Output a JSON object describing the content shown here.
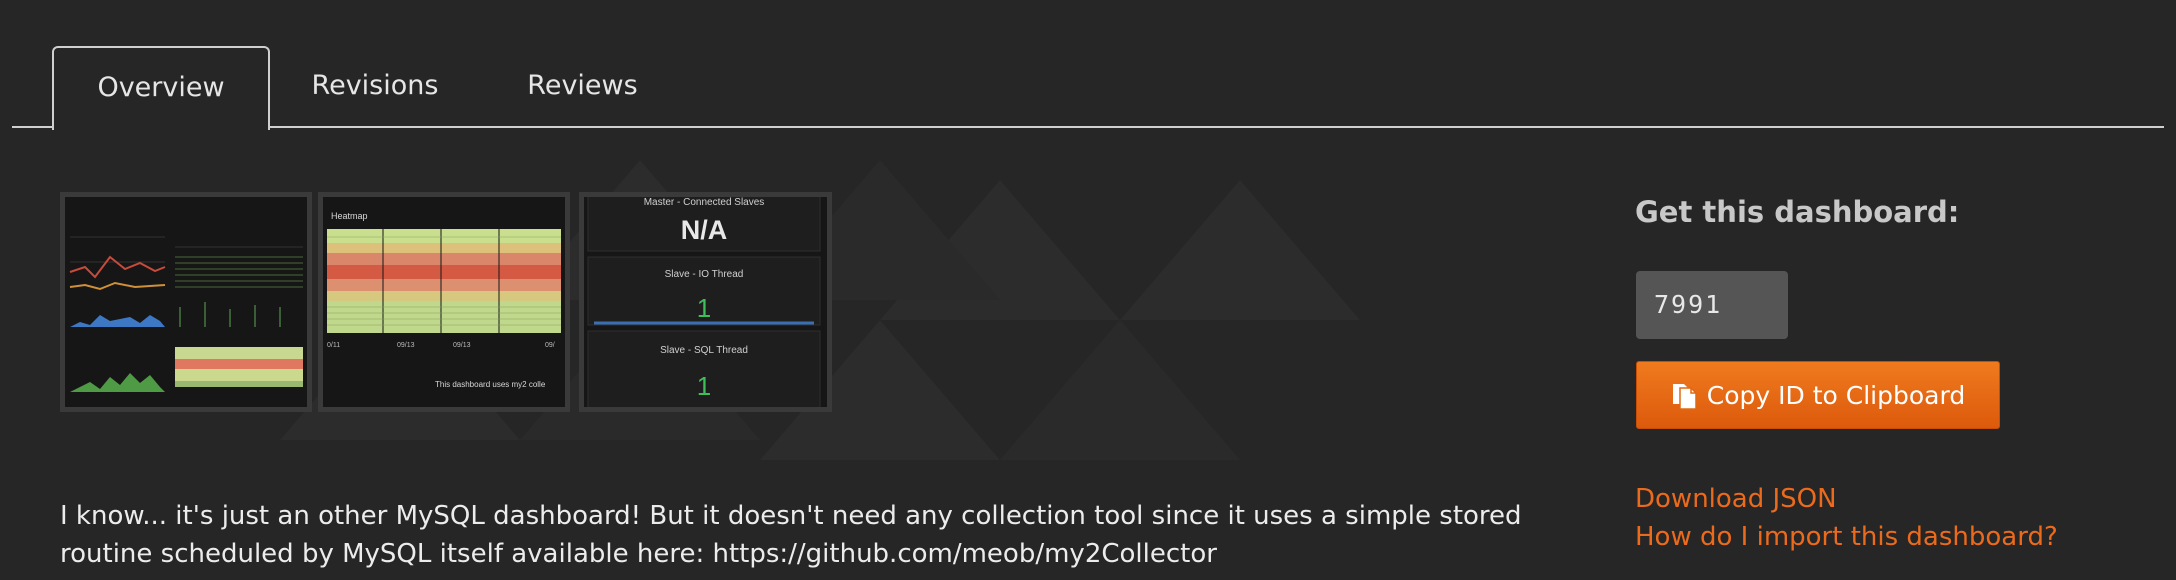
{
  "tabs": [
    {
      "label": "Overview",
      "active": true
    },
    {
      "label": "Revisions",
      "active": false
    },
    {
      "label": "Reviews",
      "active": false
    }
  ],
  "screenshots": {
    "thumb2_title": "Heatmap",
    "thumb2_axis": [
      "0/11",
      "09/13",
      "09/13",
      "09/"
    ],
    "thumb2_footer": "This dashboard uses my2 colle",
    "thumb3_panels": [
      {
        "title": "Master - Connected Slaves",
        "value": "N/A"
      },
      {
        "title": "Slave - IO Thread",
        "value": "1"
      },
      {
        "title": "Slave - SQL Thread",
        "value": "1"
      }
    ]
  },
  "sidebar": {
    "get_title": "Get this dashboard:",
    "dashboard_id": "7991",
    "copy_label": "Copy ID to Clipboard",
    "download_label": "Download JSON",
    "import_label": "How do I import this dashboard?"
  },
  "description": "I know... it's just an other MySQL dashboard! But it doesn't need any collection tool since it uses a simple stored routine scheduled by MySQL itself available here: https://github.com/meob/my2Collector",
  "colors": {
    "background": "#262626",
    "accent": "#eb6a1c",
    "button": "#e8690f"
  }
}
